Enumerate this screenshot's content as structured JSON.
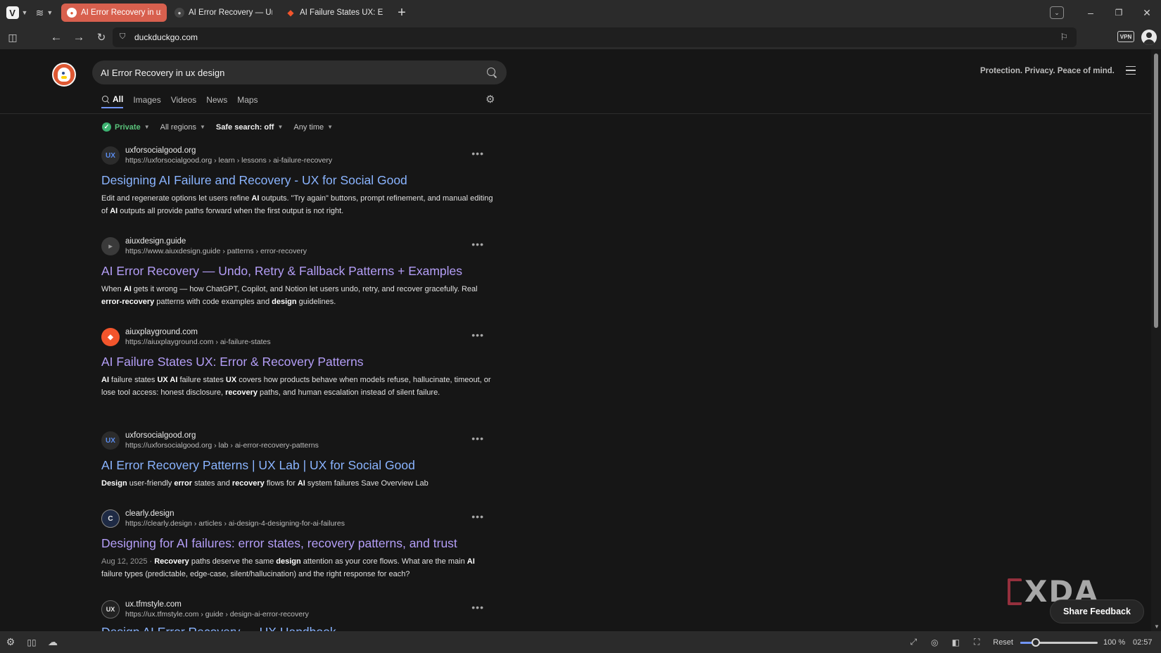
{
  "browser": {
    "tabs": [
      {
        "title": "AI Error Recovery in ux desi",
        "active": true,
        "favicon": "duckduckgo-icon"
      },
      {
        "title": "AI Error Recovery — Undo,",
        "active": false,
        "favicon": "aiuxdesign-icon"
      },
      {
        "title": "AI Failure States UX: Error &",
        "active": false,
        "favicon": "aiuxplayground-icon"
      }
    ],
    "new_tab_label": "+",
    "url": "duckduckgo.com",
    "vpn_label": "VPN"
  },
  "page": {
    "search_query": "AI Error Recovery in ux design",
    "tagline": "Protection. Privacy. Peace of mind.",
    "tabs": [
      {
        "label": "All",
        "active": true
      },
      {
        "label": "Images",
        "active": false
      },
      {
        "label": "Videos",
        "active": false
      },
      {
        "label": "News",
        "active": false
      },
      {
        "label": "Maps",
        "active": false
      }
    ],
    "filters": {
      "private": "Private",
      "region": "All regions",
      "safe_search": "Safe search: off",
      "time": "Any time"
    },
    "results": [
      {
        "site_name": "uxforsocialgood.org",
        "url": "https://uxforsocialgood.org › learn › lessons › ai-failure-recovery",
        "favicon_text": "UX",
        "favicon_color": "#5b8def",
        "title": "Designing AI Failure and Recovery - UX for Social Good",
        "visited": false,
        "snippet_html": "Edit and regenerate options let users refine <b>AI</b> outputs. \"Try again\" buttons, prompt refinement, and manual editing of <b>AI</b> outputs all provide paths forward when the first output is not right."
      },
      {
        "site_name": "aiuxdesign.guide",
        "url": "https://www.aiuxdesign.guide › patterns › error-recovery",
        "favicon_text": "▸",
        "favicon_color": "#9a9a9a",
        "title": "AI Error Recovery — Undo, Retry & Fallback Patterns + Examples",
        "visited": true,
        "snippet_html": "When <b>AI</b> gets it wrong — how ChatGPT, Copilot, and Notion let users undo, retry, and recover gracefully. Real <b>error-recovery</b> patterns with code examples and <b>design</b> guidelines."
      },
      {
        "site_name": "aiuxplayground.com",
        "url": "https://aiuxplayground.com › ai-failure-states",
        "favicon_text": "◆",
        "favicon_color": "#f2552c",
        "title": "AI Failure States UX: Error & Recovery Patterns",
        "visited": true,
        "snippet_html": "<b>AI</b> failure states <b>UX AI</b> failure states <b>UX</b> covers how products behave when models refuse, hallucinate, timeout, or lose tool access: honest disclosure, <b>recovery</b> paths, and human escalation instead of silent failure."
      },
      {
        "site_name": "uxforsocialgood.org",
        "url": "https://uxforsocialgood.org › lab › ai-error-recovery-patterns",
        "favicon_text": "UX",
        "favicon_color": "#5b8def",
        "title": "AI Error Recovery Patterns | UX Lab | UX for Social Good",
        "visited": false,
        "snippet_html": "<b>Design</b> user-friendly <b>error</b> states and <b>recovery</b> flows for <b>AI</b> system failures Save Overview Lab"
      },
      {
        "site_name": "clearly.design",
        "url": "https://clearly.design › articles › ai-design-4-designing-for-ai-failures",
        "favicon_text": "C",
        "favicon_color": "#e8e8e8",
        "title": "Designing for AI failures: error states, recovery patterns, and trust",
        "visited": true,
        "date": "Aug 12, 2025",
        "snippet_html": "<b>Recovery</b> paths deserve the same <b>design</b> attention as your core flows. What are the main <b>AI</b> failure types (predictable, edge-case, silent/hallucination) and the right response for each?"
      },
      {
        "site_name": "ux.tfmstyle.com",
        "url": "https://ux.tfmstyle.com › guide › design-ai-error-recovery",
        "favicon_text": "UX",
        "favicon_color": "#e8e8e8",
        "title": "",
        "visited": false,
        "snippet_html": ""
      }
    ],
    "partial_title": "Design AI Error Recovery — UX Handbook",
    "share_feedback_label": "Share Feedback",
    "watermark": "XDA"
  },
  "statusbar": {
    "zoom_reset_label": "Reset",
    "zoom_value": "100 %",
    "zoom_fraction": 0.2,
    "clock": "02:57"
  },
  "colors": {
    "active_tab": "#d8604e",
    "link": "#8ab4ff",
    "visited_link": "#b49ef7",
    "accent": "#7295f6"
  }
}
